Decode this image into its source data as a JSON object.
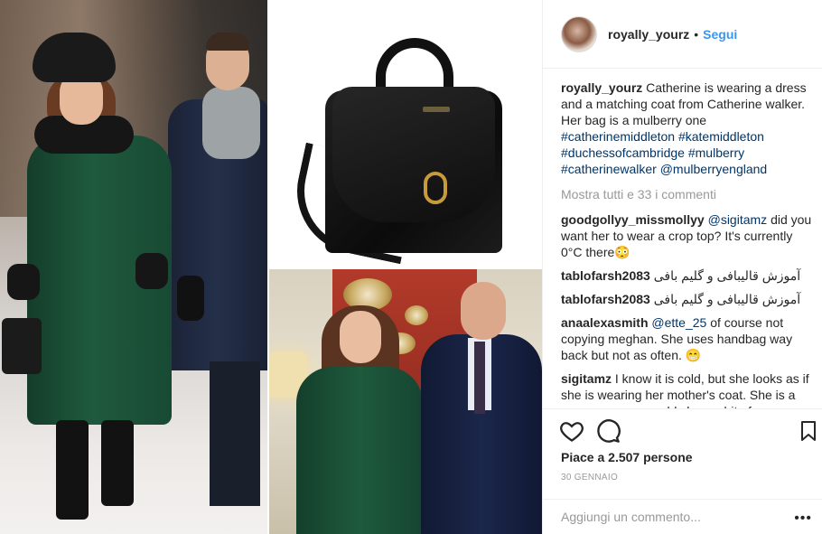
{
  "post": {
    "author": "royally_yourz",
    "separator": "•",
    "follow_label": "Segui",
    "caption": {
      "author": "royally_yourz",
      "text": "Catherine is wearing a dress and a matching coat from Catherine walker. Her bag is a mulberry one",
      "tags": "#catherinemiddleton #katemiddleton #duchessofcambridge #mulberry #catherinewalker @mulberryengland"
    },
    "show_all_comments": "Mostra tutti e 33 i commenti",
    "comments": [
      {
        "user": "goodgollyy_missmollyy",
        "mention": "@sigitamz",
        "text": "did you want her to wear a crop top? It's currently 0°C there😳"
      },
      {
        "user": "tablofarsh2083",
        "mention": "",
        "text": "آموزش قالیبافی و گلیم بافی"
      },
      {
        "user": "tablofarsh2083",
        "mention": "",
        "text": "آموزش قالیبافی و گلیم بافی"
      },
      {
        "user": "anaalexasmith",
        "mention": "@ette_25",
        "text": "of course not copying meghan. She uses handbag way back but not as often. 😁"
      },
      {
        "user": "sigitamz",
        "mention": "",
        "text": "I know it is cold, but she looks as if she is wearing her mother's coat. She is a young woman, could show a bit of a"
      }
    ],
    "likes": "Piace a 2.507 persone",
    "date": "30 GENNAIO",
    "add_comment_placeholder": "Aggiungi un commento...",
    "more_label": "•••"
  },
  "icons": {
    "like": "heart-icon",
    "comment": "comment-icon",
    "save": "bookmark-icon",
    "more": "more-icon"
  },
  "colors": {
    "link": "#003569",
    "follow": "#3897f0",
    "muted": "#999999",
    "border": "#efefef",
    "text": "#262626"
  }
}
